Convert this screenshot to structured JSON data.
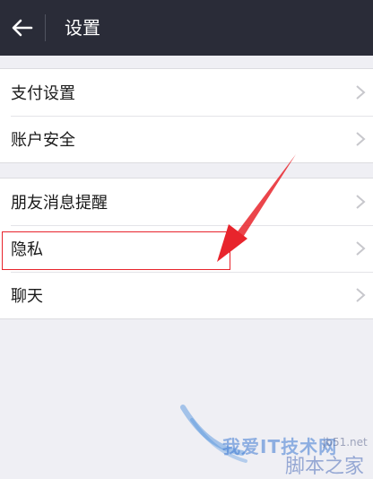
{
  "header": {
    "title": "设置",
    "back_icon": "arrow-left-icon"
  },
  "groups": [
    {
      "items": [
        {
          "label": "支付设置"
        },
        {
          "label": "账户安全"
        }
      ]
    },
    {
      "items": [
        {
          "label": "朋友消息提醒"
        },
        {
          "label": "隐私"
        },
        {
          "label": "聊天"
        }
      ]
    }
  ],
  "annotation": {
    "highlighted_item": "隐私",
    "color": "#e8242c"
  },
  "watermark": {
    "text": "我爱IT技术网",
    "site": "脚本之家",
    "url": "jb51.net"
  },
  "colors": {
    "topbar": "#2a2c38",
    "background": "#efeff4",
    "row_bg": "#ffffff",
    "chevron": "#c7c7cc"
  }
}
